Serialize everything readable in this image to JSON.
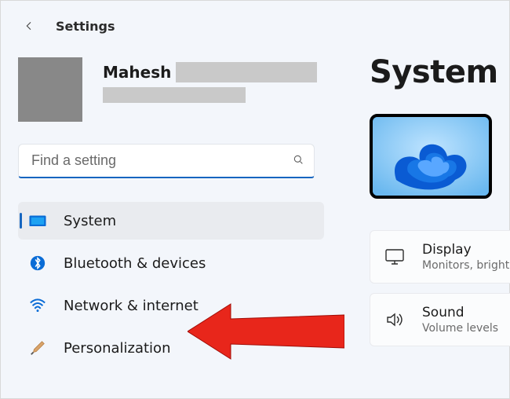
{
  "app": {
    "title": "Settings"
  },
  "user": {
    "name_first": "Mahesh"
  },
  "search": {
    "placeholder": "Find a setting"
  },
  "nav": {
    "items": [
      {
        "key": "system",
        "label": "System",
        "icon": "monitor-icon",
        "selected": true
      },
      {
        "key": "bluetooth",
        "label": "Bluetooth & devices",
        "icon": "bluetooth-icon",
        "selected": false
      },
      {
        "key": "network",
        "label": "Network & internet",
        "icon": "wifi-icon",
        "selected": false
      },
      {
        "key": "personalization",
        "label": "Personalization",
        "icon": "brush-icon",
        "selected": false
      }
    ]
  },
  "page": {
    "title": "System"
  },
  "cards": [
    {
      "key": "display",
      "title": "Display",
      "subtitle": "Monitors, brightness",
      "icon": "monitor-outline-icon"
    },
    {
      "key": "sound",
      "title": "Sound",
      "subtitle": "Volume levels",
      "icon": "speaker-icon"
    }
  ],
  "colors": {
    "accent": "#1665c0",
    "nav_selected_bg": "#e9ebef",
    "arrow": "#e8261b"
  }
}
